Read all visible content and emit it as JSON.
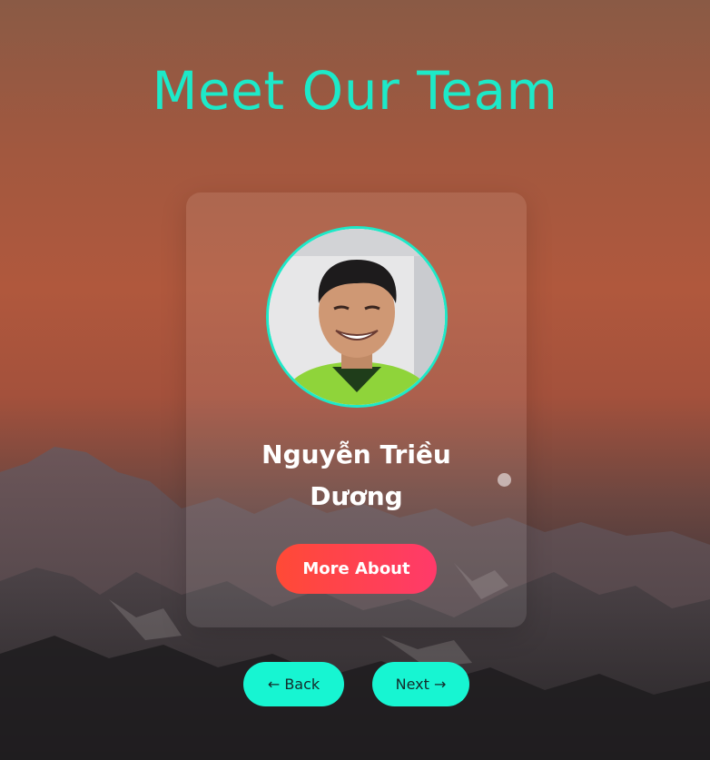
{
  "page": {
    "title": "Meet Our Team"
  },
  "member": {
    "name": "Nguyễn Triều Dương",
    "more_label": "More About"
  },
  "nav": {
    "back_label": "← Back",
    "next_label": "Next →"
  },
  "colors": {
    "accent": "#1de9c8",
    "button_gradient_start": "#ff4a36",
    "button_gradient_end": "#ff3a6a",
    "nav_button": "#17f5d2"
  }
}
